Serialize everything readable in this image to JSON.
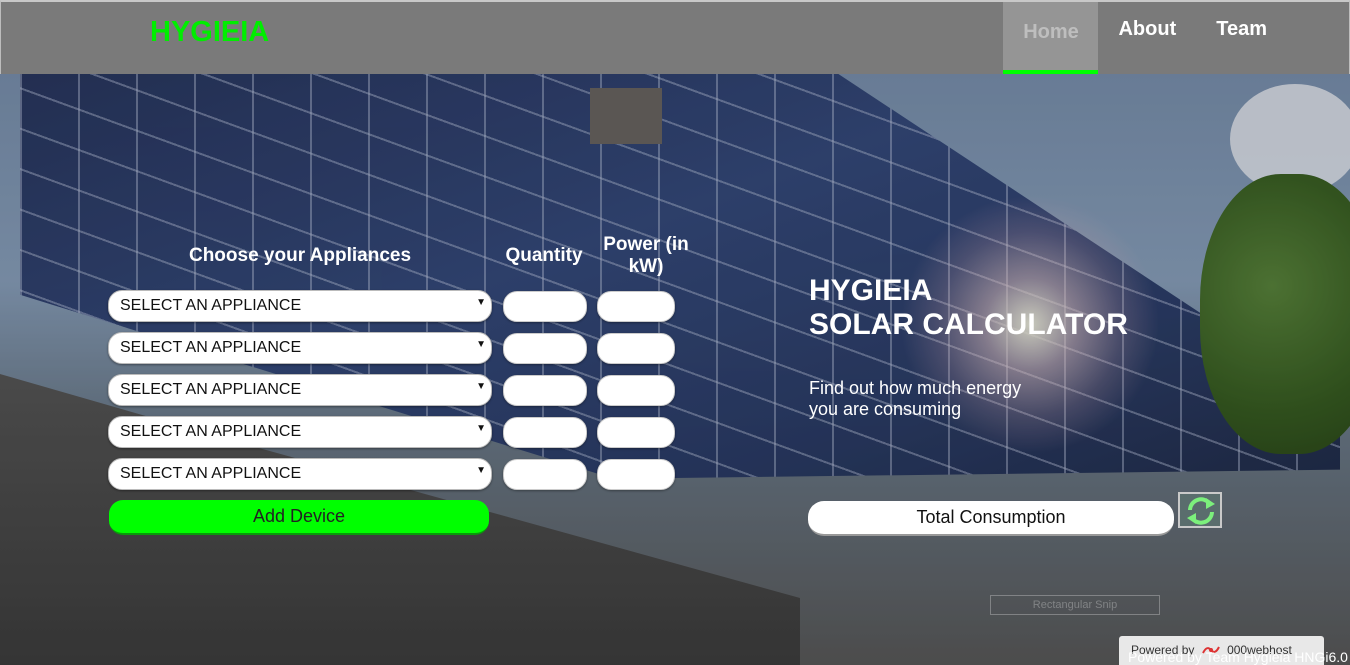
{
  "brand": "HYGIEIA",
  "nav": {
    "home": "Home",
    "about": "About",
    "team": "Team"
  },
  "form": {
    "headers": {
      "appliance": "Choose your Appliances",
      "quantity": "Quantity",
      "power": "Power (in kW)"
    },
    "rows": [
      {
        "appliance": "SELECT AN APPLIANCE",
        "quantity": "",
        "power": ""
      },
      {
        "appliance": "SELECT AN APPLIANCE",
        "quantity": "",
        "power": ""
      },
      {
        "appliance": "SELECT AN APPLIANCE",
        "quantity": "",
        "power": ""
      },
      {
        "appliance": "SELECT AN APPLIANCE",
        "quantity": "",
        "power": ""
      },
      {
        "appliance": "SELECT AN APPLIANCE",
        "quantity": "",
        "power": ""
      }
    ],
    "add_device": "Add Device"
  },
  "hero": {
    "title_line1": "HYGIEIA",
    "title_line2": "SOLAR CALCULATOR",
    "subtitle_line1": "Find out how much energy",
    "subtitle_line2": "you are consuming",
    "total_button": "Total Consumption",
    "refresh_icon": "refresh-icon"
  },
  "footer": {
    "watermark": "Rectangular Snip",
    "powered_by": "Powered by",
    "host": "000webhost",
    "credit": "Powered by Team Hygieia HNGi6.0"
  },
  "colors": {
    "accent": "#00ff00",
    "brand": "#00ee00",
    "nav_bg": "#7a7a7a"
  }
}
